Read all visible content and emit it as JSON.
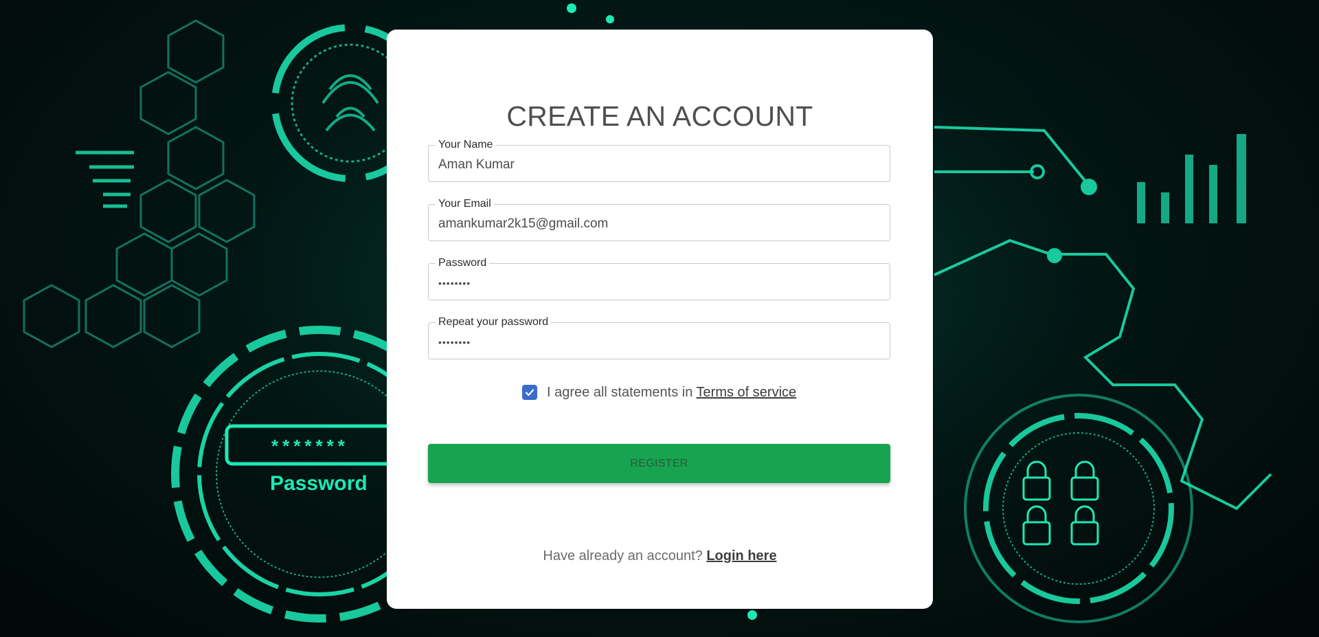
{
  "page": {
    "title": "CREATE AN ACCOUNT"
  },
  "form": {
    "name": {
      "label": "Your Name",
      "value": "Aman Kumar"
    },
    "email": {
      "label": "Your Email",
      "value": "amankumar2k15@gmail.com"
    },
    "password": {
      "label": "Password",
      "value": "••••••••"
    },
    "repeat_password": {
      "label": "Repeat your password",
      "value": "••••••••"
    },
    "agree": {
      "checked": true,
      "text": "I agree all statements in",
      "link_text": "Terms of service"
    },
    "register_label": "REGISTER"
  },
  "footer": {
    "text": "Have already an account?",
    "link_text": "Login here"
  },
  "background": {
    "password_badge_text": "Password",
    "password_badge_stars": "*******"
  },
  "colors": {
    "accent_teal": "#1de9b6",
    "register_green": "#17a34f",
    "checkbox_blue": "#3a6ccc"
  }
}
